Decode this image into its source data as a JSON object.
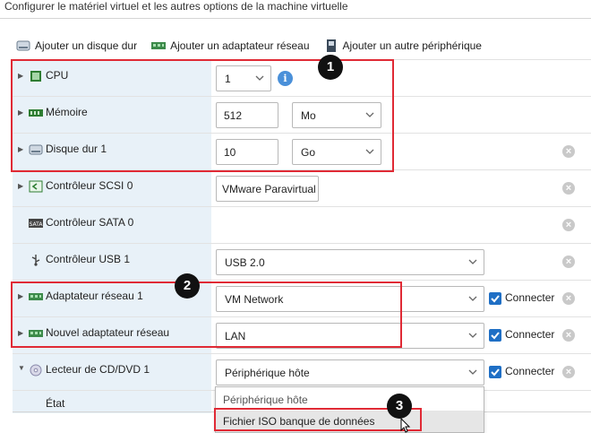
{
  "header": {
    "title": "Configurer le matériel virtuel et les autres options de la machine virtuelle"
  },
  "toolbar": {
    "add_disk": "Ajouter un disque dur",
    "add_network": "Ajouter un adaptateur réseau",
    "add_other": "Ajouter un autre périphérique"
  },
  "devices": {
    "cpu": {
      "label": "CPU",
      "value": "1"
    },
    "memory": {
      "label": "Mémoire",
      "value": "512",
      "unit": "Mo"
    },
    "disk": {
      "label": "Disque dur 1",
      "value": "10",
      "unit": "Go"
    },
    "scsi": {
      "label": "Contrôleur SCSI 0",
      "value": "VMware Paravirtual"
    },
    "sata": {
      "label": "Contrôleur SATA 0"
    },
    "usb": {
      "label": "Contrôleur USB 1",
      "value": "USB 2.0"
    },
    "net1": {
      "label": "Adaptateur réseau 1",
      "value": "VM Network",
      "connect": "Connecter"
    },
    "net2": {
      "label": "Nouvel adaptateur réseau",
      "value": "LAN",
      "connect": "Connecter"
    },
    "cd": {
      "label": "Lecteur de CD/DVD 1",
      "value": "Périphérique hôte",
      "connect": "Connecter"
    },
    "state": {
      "label": "État"
    }
  },
  "dropdown": {
    "options": [
      "Périphérique hôte",
      "Fichier ISO banque de données"
    ]
  },
  "badges": [
    "1",
    "2",
    "3"
  ],
  "colors": {
    "accent": "#1f6fc5",
    "highlight": "#e02a35",
    "row_bg": "#e8f1f8"
  }
}
